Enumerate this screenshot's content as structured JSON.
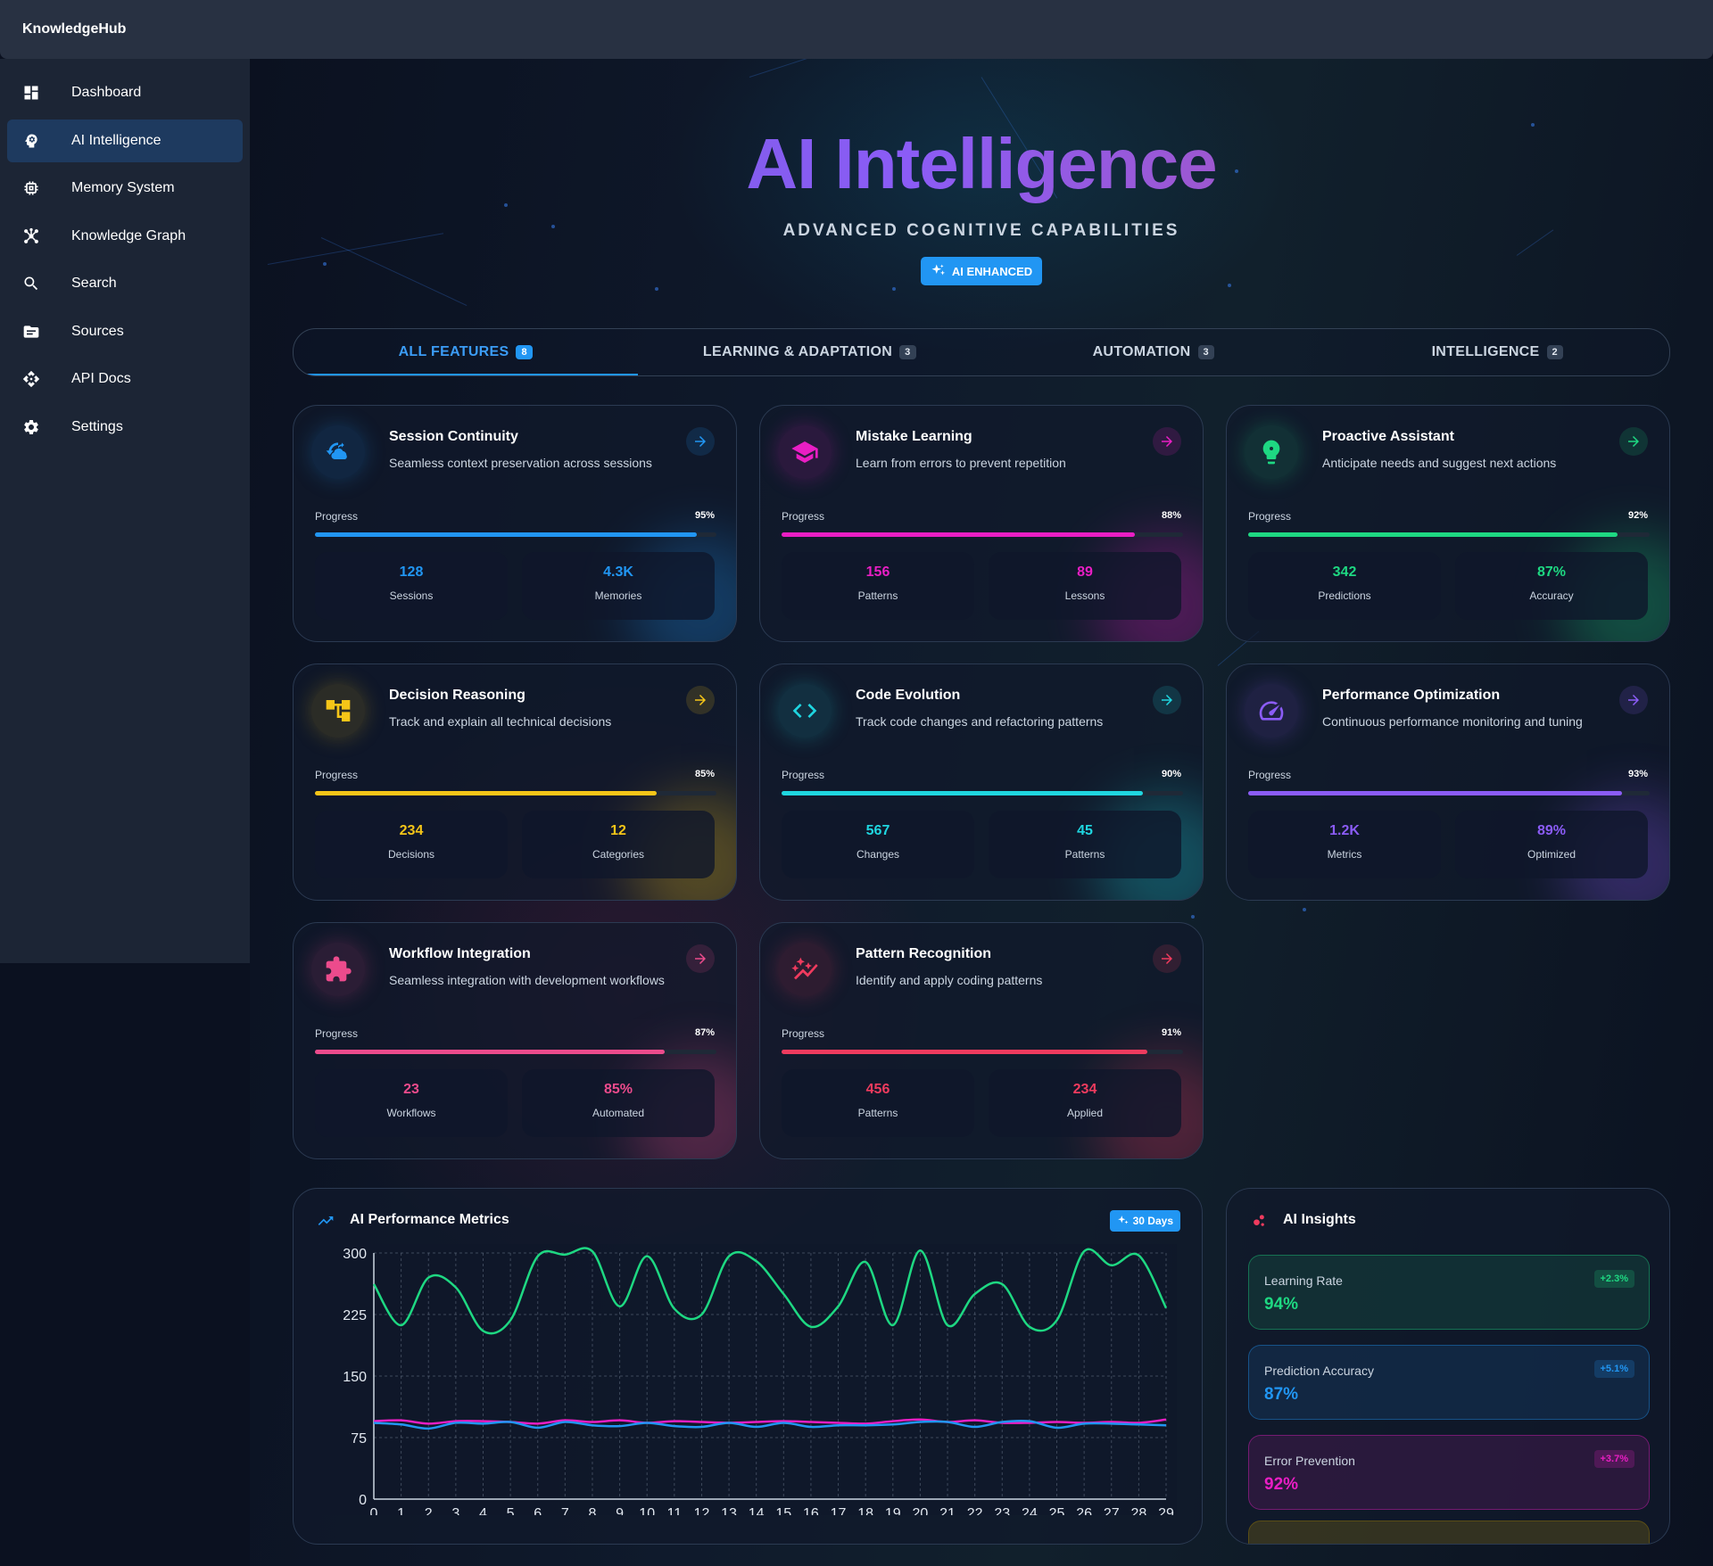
{
  "app": {
    "brand": "KnowledgeHub"
  },
  "sidebar": {
    "items": [
      {
        "label": "Dashboard",
        "icon": "dashboard-icon"
      },
      {
        "label": "AI Intelligence",
        "icon": "brain-icon",
        "active": true
      },
      {
        "label": "Memory System",
        "icon": "chip-icon"
      },
      {
        "label": "Knowledge Graph",
        "icon": "graph-icon"
      },
      {
        "label": "Search",
        "icon": "search-icon"
      },
      {
        "label": "Sources",
        "icon": "folder-icon"
      },
      {
        "label": "API Docs",
        "icon": "api-icon"
      },
      {
        "label": "Settings",
        "icon": "gear-icon"
      }
    ]
  },
  "hero": {
    "title": "AI Intelligence",
    "subtitle": "ADVANCED COGNITIVE CAPABILITIES",
    "badge": "AI ENHANCED"
  },
  "tabs": [
    {
      "label": "ALL FEATURES",
      "count": "8",
      "active": true
    },
    {
      "label": "LEARNING & ADAPTATION",
      "count": "3"
    },
    {
      "label": "AUTOMATION",
      "count": "3"
    },
    {
      "label": "INTELLIGENCE",
      "count": "2"
    }
  ],
  "progress_label": "Progress",
  "cards": [
    {
      "title": "Session Continuity",
      "desc": "Seamless context preservation across sessions",
      "progress": "95%",
      "progress_value": 95,
      "color": "#2196f3",
      "icon": "session-sync-icon",
      "stats": [
        {
          "value": "128",
          "label": "Sessions"
        },
        {
          "value": "4.3K",
          "label": "Memories"
        }
      ]
    },
    {
      "title": "Mistake Learning",
      "desc": "Learn from errors to prevent repetition",
      "progress": "88%",
      "progress_value": 88,
      "color": "#e91ec4",
      "icon": "graduation-cap-icon",
      "stats": [
        {
          "value": "156",
          "label": "Patterns"
        },
        {
          "value": "89",
          "label": "Lessons"
        }
      ]
    },
    {
      "title": "Proactive Assistant",
      "desc": "Anticipate needs and suggest next actions",
      "progress": "92%",
      "progress_value": 92,
      "color": "#1ed882",
      "icon": "brain-bulb-icon",
      "stats": [
        {
          "value": "342",
          "label": "Predictions"
        },
        {
          "value": "87%",
          "label": "Accuracy"
        }
      ]
    },
    {
      "title": "Decision Reasoning",
      "desc": "Track and explain all technical decisions",
      "progress": "85%",
      "progress_value": 85,
      "color": "#f5c518",
      "icon": "decision-tree-icon",
      "stats": [
        {
          "value": "234",
          "label": "Decisions"
        },
        {
          "value": "12",
          "label": "Categories"
        }
      ]
    },
    {
      "title": "Code Evolution",
      "desc": "Track code changes and refactoring patterns",
      "progress": "90%",
      "progress_value": 90,
      "color": "#1fd6e0",
      "icon": "code-icon",
      "stats": [
        {
          "value": "567",
          "label": "Changes"
        },
        {
          "value": "45",
          "label": "Patterns"
        }
      ]
    },
    {
      "title": "Performance Optimization",
      "desc": "Continuous performance monitoring and tuning",
      "progress": "93%",
      "progress_value": 93,
      "color": "#8b5cf6",
      "icon": "speedometer-icon",
      "stats": [
        {
          "value": "1.2K",
          "label": "Metrics"
        },
        {
          "value": "89%",
          "label": "Optimized"
        }
      ]
    },
    {
      "title": "Workflow Integration",
      "desc": "Seamless integration with development workflows",
      "progress": "87%",
      "progress_value": 87,
      "color": "#ec4b8c",
      "icon": "puzzle-icon",
      "stats": [
        {
          "value": "23",
          "label": "Workflows"
        },
        {
          "value": "85%",
          "label": "Automated"
        }
      ]
    },
    {
      "title": "Pattern Recognition",
      "desc": "Identify and apply coding patterns",
      "progress": "91%",
      "progress_value": 91,
      "color": "#ef3b5e",
      "icon": "auto-graph-icon",
      "stats": [
        {
          "value": "456",
          "label": "Patterns"
        },
        {
          "value": "234",
          "label": "Applied"
        }
      ]
    }
  ],
  "metrics_panel": {
    "title": "AI Performance Metrics",
    "badge": "30 Days"
  },
  "chart_data": {
    "type": "line",
    "x": [
      0,
      1,
      2,
      3,
      4,
      5,
      6,
      7,
      8,
      9,
      10,
      11,
      12,
      13,
      14,
      15,
      16,
      17,
      18,
      19,
      20,
      21,
      22,
      23,
      24,
      25,
      26,
      27,
      28,
      29
    ],
    "ylim": [
      0,
      300
    ],
    "yticks": [
      0,
      75,
      150,
      225,
      300
    ],
    "grid": true,
    "series": [
      {
        "color": "#1ed882",
        "values": [
          262,
          212,
          270,
          258,
          205,
          218,
          296,
          298,
          302,
          235,
          296,
          232,
          225,
          296,
          290,
          250,
          210,
          235,
          289,
          212,
          303,
          212,
          250,
          262,
          210,
          218,
          302,
          285,
          297,
          233
        ]
      },
      {
        "color": "#e91ec4",
        "values": [
          95,
          96,
          92,
          95,
          95,
          94,
          92,
          96,
          94,
          96,
          93,
          95,
          94,
          93,
          94,
          95,
          94,
          93,
          92,
          95,
          97,
          94,
          96,
          93,
          93,
          94,
          93,
          94,
          93,
          97
        ]
      },
      {
        "color": "#2196f3",
        "values": [
          93,
          91,
          86,
          93,
          92,
          94,
          87,
          94,
          90,
          89,
          93,
          89,
          88,
          93,
          88,
          93,
          88,
          90,
          90,
          91,
          94,
          94,
          88,
          94,
          95,
          87,
          92,
          92,
          91,
          90
        ]
      }
    ]
  },
  "insights_panel": {
    "title": "AI Insights",
    "items": [
      {
        "label": "Learning Rate",
        "value": "94%",
        "delta": "+2.3%",
        "color": "#1ed882"
      },
      {
        "label": "Prediction Accuracy",
        "value": "87%",
        "delta": "+5.1%",
        "color": "#2196f3"
      },
      {
        "label": "Error Prevention",
        "value": "92%",
        "delta": "+3.7%",
        "color": "#e91ec4"
      }
    ]
  }
}
